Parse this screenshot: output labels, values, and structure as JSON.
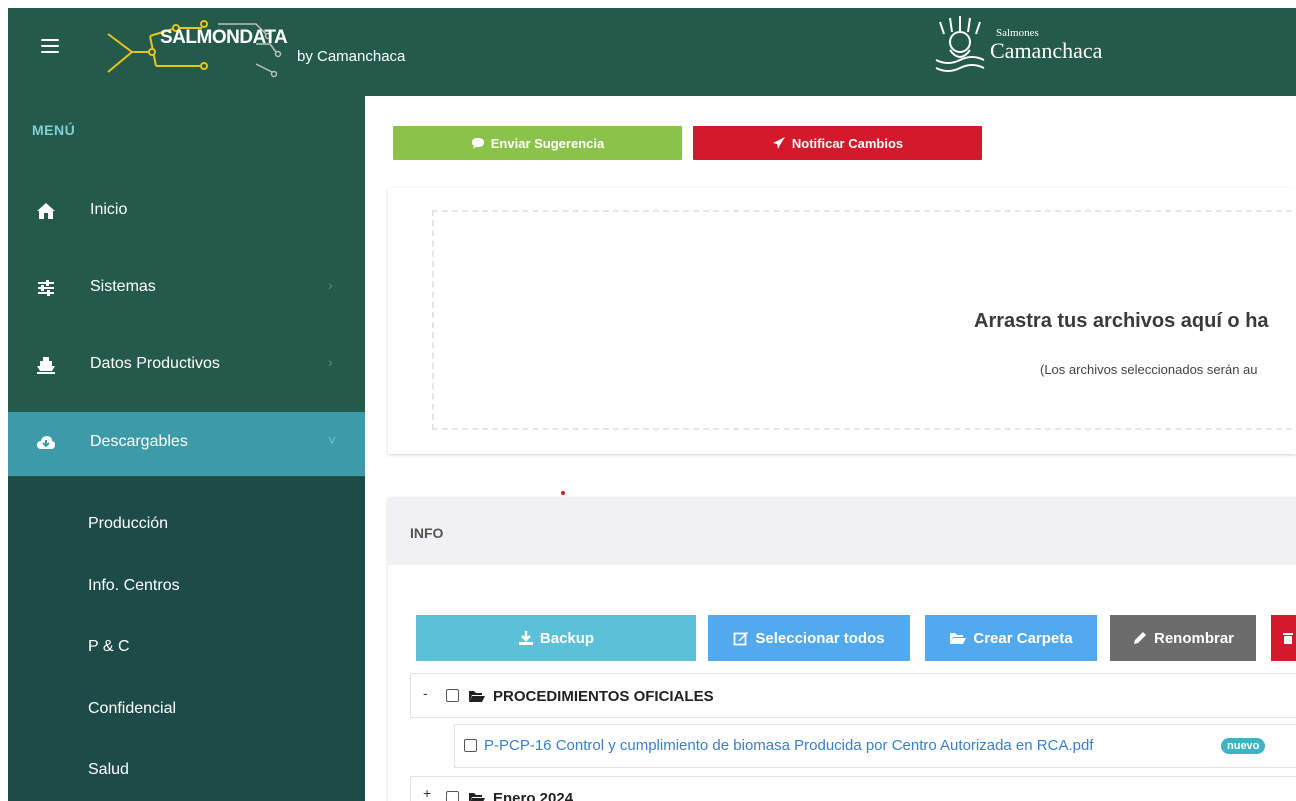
{
  "header": {
    "logo_text": "SALMONDATA",
    "byline": "by Camanchaca",
    "brand_small": "Salmones",
    "brand_big": "Camanchaca"
  },
  "sidebar": {
    "menu_label": "MENÚ",
    "items": [
      {
        "label": "Inicio",
        "icon": "home-icon"
      },
      {
        "label": "Sistemas",
        "icon": "sliders-icon"
      },
      {
        "label": "Datos Productivos",
        "icon": "ship-icon"
      },
      {
        "label": "Descargables",
        "icon": "cloud-download-icon"
      }
    ],
    "subitems": [
      "Producción",
      "Info. Centros",
      "P & C",
      "Confidencial",
      "Salud"
    ]
  },
  "actions": {
    "suggest_label": "Enviar Sugerencia",
    "notify_label": "Notificar Cambios"
  },
  "upload": {
    "title": "Arrastra tus archivos aquí o ha",
    "subtitle": "(Los archivos seleccionados serán au"
  },
  "info": {
    "title": "INFO",
    "toolbar": {
      "backup": "Backup",
      "select_all": "Seleccionar todos",
      "create_folder": "Crear Carpeta",
      "rename": "Renombrar"
    },
    "tree": {
      "folder1": {
        "toggle": "-",
        "name": "PROCEDIMIENTOS OFICIALES"
      },
      "file1": {
        "name": "P-PCP-16 Control y cumplimiento de biomasa Producida por Centro Autorizada en RCA.pdf",
        "badge": "nuevo"
      },
      "folder2": {
        "toggle": "+",
        "name": "Enero 2024"
      }
    }
  },
  "colors": {
    "header_bg": "#245a4a",
    "active_item": "#3d9aa9",
    "suggest_btn": "#8bc34a",
    "notify_btn": "#d3192b",
    "backup_btn": "#5bc0d8",
    "primary_btn": "#52a9ee",
    "rename_btn": "#6c6c6c",
    "delete_btn": "#d3192b"
  }
}
